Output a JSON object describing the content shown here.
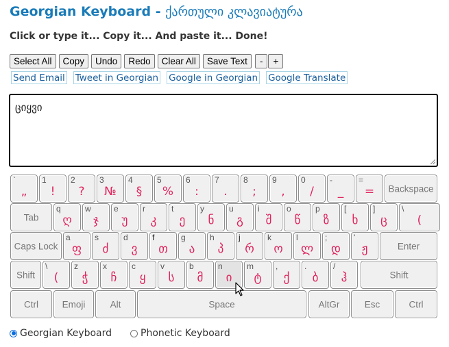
{
  "header": {
    "title_en": "Georgian Keyboard - ",
    "title_ka": "ქართული კლავიატურა",
    "subtitle": "Click or type it... Copy it... And paste it... Done!"
  },
  "toolbar": {
    "select_all": "Select All",
    "copy": "Copy",
    "undo": "Undo",
    "redo": "Redo",
    "clear_all": "Clear All",
    "save_text": "Save Text",
    "minus": "-",
    "plus": "+"
  },
  "links": {
    "send_email": "Send Email",
    "tweet": "Tweet in Georgian",
    "google_search": "Google in Georgian",
    "google_translate": "Google Translate"
  },
  "editor": {
    "value": "ციყვი"
  },
  "keyboard": {
    "row1": [
      {
        "small": "`",
        "big": "„"
      },
      {
        "small": "1",
        "big": "!"
      },
      {
        "small": "2",
        "big": "?"
      },
      {
        "small": "3",
        "big": "№"
      },
      {
        "small": "4",
        "big": "§"
      },
      {
        "small": "5",
        "big": "%"
      },
      {
        "small": "6",
        "big": ":"
      },
      {
        "small": "7",
        "big": "."
      },
      {
        "small": "8",
        "big": ";"
      },
      {
        "small": "9",
        "big": ","
      },
      {
        "small": "0",
        "big": "/"
      },
      {
        "small": "-",
        "big": "_"
      },
      {
        "small": "=",
        "big": "="
      }
    ],
    "backspace": "Backspace",
    "tab": "Tab",
    "row2": [
      {
        "small": "q",
        "big": "ღ"
      },
      {
        "small": "w",
        "big": "ჯ"
      },
      {
        "small": "e",
        "big": "უ"
      },
      {
        "small": "r",
        "big": "კ"
      },
      {
        "small": "t",
        "big": "ე"
      },
      {
        "small": "y",
        "big": "ნ"
      },
      {
        "small": "u",
        "big": "გ"
      },
      {
        "small": "i",
        "big": "შ"
      },
      {
        "small": "o",
        "big": "წ"
      },
      {
        "small": "p",
        "big": "ზ"
      },
      {
        "small": "[",
        "big": "ხ"
      },
      {
        "small": "]",
        "big": "ც"
      },
      {
        "small": "\\",
        "big": "("
      }
    ],
    "caps_lock": "Caps Lock",
    "row3": [
      {
        "small": "a",
        "big": "ფ"
      },
      {
        "small": "s",
        "big": "ძ"
      },
      {
        "small": "d",
        "big": "ვ"
      },
      {
        "small": "f",
        "big": "თ"
      },
      {
        "small": "g",
        "big": "ა"
      },
      {
        "small": "h",
        "big": "პ"
      },
      {
        "small": "j",
        "big": "რ"
      },
      {
        "small": "k",
        "big": "ო"
      },
      {
        "small": "l",
        "big": "ლ"
      },
      {
        "small": ";",
        "big": "დ"
      },
      {
        "small": "'",
        "big": "ჟ"
      }
    ],
    "enter": "Enter",
    "shift": "Shift",
    "row4": [
      {
        "small": "\\",
        "big": "("
      },
      {
        "small": "z",
        "big": "ჭ"
      },
      {
        "small": "x",
        "big": "ჩ"
      },
      {
        "small": "c",
        "big": "ყ"
      },
      {
        "small": "v",
        "big": "ს"
      },
      {
        "small": "b",
        "big": "მ"
      },
      {
        "small": "n",
        "big": "ი"
      },
      {
        "small": "m",
        "big": "ტ"
      },
      {
        "small": ",",
        "big": "ქ"
      },
      {
        "small": ".",
        "big": "ბ"
      },
      {
        "small": "/",
        "big": "ჰ"
      }
    ],
    "shift_right": "Shift",
    "row5": {
      "ctrl_left": "Ctrl",
      "emoji": "Emoji",
      "alt": "Alt",
      "space": "Space",
      "altgr": "AltGr",
      "esc": "Esc",
      "ctrl_right": "Ctrl"
    },
    "hovered_key": "n"
  },
  "layout_options": {
    "georgian": "Georgian Keyboard",
    "phonetic": "Phonetic Keyboard",
    "selected": "georgian"
  },
  "colors": {
    "title": "#1a7bb9",
    "key_glyph": "#e0245e",
    "link_border": "#a8d4e6",
    "radio_selected": "#0b6de0"
  }
}
